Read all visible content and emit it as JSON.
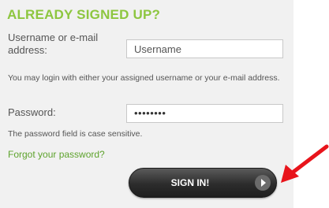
{
  "login_panel": {
    "heading": "ALREADY SIGNED UP?",
    "username_label": "Username or e-mail address:",
    "username_placeholder": "Username",
    "username_hint": "You may login with either your assigned username or your e-mail address.",
    "password_label": "Password:",
    "password_mask": "••••••••",
    "password_hint": "The password field is case sensitive.",
    "forgot_link": "Forgot your password?",
    "signin_button": "SIGN IN!"
  },
  "icons": {
    "signin_arrow": "play-triangle-icon",
    "annotation": "red-arrow-icon"
  },
  "colors": {
    "accent_green": "#8dc63f",
    "link_green": "#5ea32d",
    "annotation_red": "#e8141b"
  }
}
